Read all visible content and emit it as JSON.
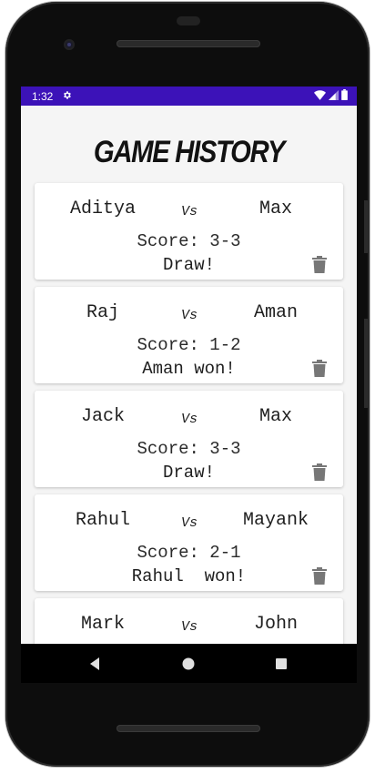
{
  "status_bar": {
    "time": "1:32",
    "settings_icon": "gear-icon",
    "wifi_icon": "wifi-icon",
    "signal_icon": "signal-icon",
    "battery_icon": "battery-icon"
  },
  "page": {
    "title": "GAME HISTORY"
  },
  "games": [
    {
      "player1": "Aditya",
      "vs": "Vs",
      "player2": "Max",
      "score": "Score: 3-3",
      "result": "Draw!",
      "delete_icon": "trash-icon"
    },
    {
      "player1": "Raj",
      "vs": "Vs",
      "player2": "Aman",
      "score": "Score: 1-2",
      "result": "Aman won!",
      "delete_icon": "trash-icon"
    },
    {
      "player1": "Jack",
      "vs": "Vs",
      "player2": "Max",
      "score": "Score: 3-3",
      "result": "Draw!",
      "delete_icon": "trash-icon"
    },
    {
      "player1": "Rahul",
      "vs": "Vs",
      "player2": "Mayank",
      "score": "Score: 2-1",
      "result": "Rahul  won!",
      "delete_icon": "trash-icon"
    },
    {
      "player1": "Mark",
      "vs": "Vs",
      "player2": "John",
      "score": "",
      "result": "",
      "delete_icon": "trash-icon"
    }
  ],
  "nav_bar": {
    "back_icon": "back-triangle-icon",
    "home_icon": "home-circle-icon",
    "recents_icon": "recents-square-icon"
  },
  "colors": {
    "status_bar": "#3c12b8",
    "screen_bg": "#f5f5f5",
    "card_bg": "#ffffff",
    "trash": "#777777"
  }
}
